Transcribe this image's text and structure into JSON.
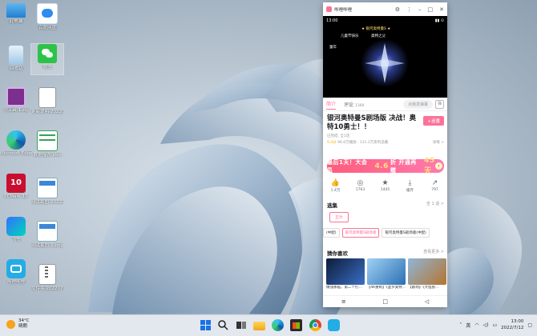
{
  "desktop": {
    "icons": [
      {
        "label": "此电脑",
        "name": "this-pc-icon"
      },
      {
        "label": "百度网盘",
        "name": "baidu-netdisk-icon"
      },
      {
        "label": "回收站",
        "name": "recycle-bin-icon"
      },
      {
        "label": "微信",
        "name": "wechat-icon"
      },
      {
        "label": "小工具-1.zip",
        "name": "zip-file-icon"
      },
      {
        "label": "更新说明-20220711.txt",
        "name": "text-file-icon"
      },
      {
        "label": "Microsoft Edge",
        "name": "edge-icon"
      },
      {
        "label": "数据报表.xlsx",
        "name": "spreadsheet-icon"
      },
      {
        "label": "PCMark 10",
        "name": "pcmark-icon"
      },
      {
        "label": "测试截图-20220712.png",
        "name": "image-file-icon-1"
      },
      {
        "label": "飞书",
        "name": "feishu-icon"
      },
      {
        "label": "测试截图-1.png",
        "name": "image-file-icon-2"
      },
      {
        "label": "哔哩哔哩",
        "name": "bilibili-icon"
      },
      {
        "label": "文件夹-20220712.zip",
        "name": "archive-file-icon"
      }
    ]
  },
  "phone": {
    "app_title": "哔哩哔哩",
    "status_time": "13:00",
    "tab_intro": "简介",
    "tab_comments": "评论",
    "comment_count": "1368",
    "danmaku_placeholder": "点我发弹幕",
    "video_title": "银河奥特曼S剧场版 决战！奥特10勇士！！",
    "follow_label": "+追番",
    "uploader": "已完结, 全1话",
    "rating": "9.4分",
    "stats": "96.6万播放 · 131.2万系列追番",
    "detail_link": "详情 >",
    "promo": {
      "left": "最后1天！大会员",
      "discount": "4.6",
      "mid": "折  开通再赠",
      "days": "45天",
      "btn": "›"
    },
    "actions": [
      {
        "icon": "like-icon",
        "glyph": "👍",
        "count": "1.4万"
      },
      {
        "icon": "coin-icon",
        "glyph": "◎",
        "count": "1763"
      },
      {
        "icon": "favorite-icon",
        "glyph": "★",
        "count": "1445"
      },
      {
        "icon": "cache-icon",
        "glyph": "⤓",
        "count": "缓存"
      },
      {
        "icon": "share-icon",
        "glyph": "↗",
        "count": "797"
      }
    ],
    "episodes_header": "选集",
    "episodes_more": "全 1 话 >",
    "vip_chip": "正片",
    "episodes": [
      "(中配)",
      "银河奥特曼S剧场版",
      "银河奥特曼S剧场版(中配)"
    ],
    "recommend_header": "猜你喜欢",
    "recommend_more": "查看更多 >",
    "recommend": [
      {
        "caption": "做涨那脑，第二个打…",
        "color": "#2b4a7a"
      },
      {
        "caption": "【4K重制】《圣罗奥特…",
        "color": "#3a78b8"
      },
      {
        "caption": "【剧场】《大怪兽…",
        "color": "#b07a3a"
      }
    ]
  },
  "taskbar": {
    "weather_temp": "34°C",
    "weather_desc": "晴朗",
    "ime": "英",
    "time": "13:00",
    "date": "2022/7/12"
  }
}
